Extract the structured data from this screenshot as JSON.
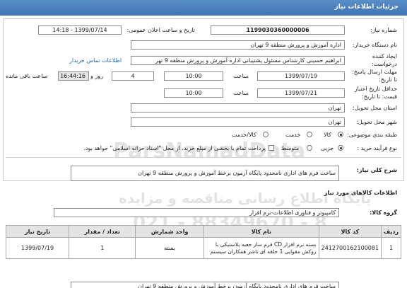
{
  "header": {
    "title": "جزئیات اطلاعات نیاز"
  },
  "form": {
    "need_number_label": "شماره نیاز:",
    "need_number": "1199030360000006",
    "announce_label": "تاریخ و ساعت اعلان عمومی:",
    "announce_value": "1399/07/14 - 14:18",
    "buyer_label": "نام دستگاه خریدار:",
    "buyer_value": "اداره آموزش و پرورش منطقه 9 تهران",
    "creator_label_1": "ایجاد کننده",
    "creator_label_2": "درخواست:",
    "creator_value": "ابراهیم حسینی کارشناس مسئول پشتیبانی اداره آموزش و پرورش منطقه 9 تهر",
    "contact_link": "اطلاعات تماس خریدار",
    "deadline_label_1": "مهلت ارسال پاسخ:",
    "deadline_label_2": "تا تاریخ:",
    "deadline_date": "1399/07/19",
    "time_label": "ساعت",
    "deadline_time": "10:00",
    "days_value": "4",
    "days_label": "روز و",
    "remaining_time": "16:44:16",
    "remaining_label": "ساعت باقی مانده",
    "validity_label_1": "حداقل تاریخ اعتبار",
    "validity_label_2": "قیمت: تا تاریخ:",
    "validity_date": "1399/07/21",
    "validity_time": "10:00",
    "province_label": "استان محل تحویل:",
    "province_value": "تهران",
    "city_label": "شهر محل تحویل:",
    "city_value": "تهران",
    "category_label": "طبقه بندی موضوعی:",
    "category_options": [
      "کالا",
      "خدمت",
      "کالا/خدمت"
    ],
    "process_label": "نوع فرآیند خرید :",
    "process_options": [
      "جزیی",
      "متوسط"
    ],
    "payment_note": "پرداخت تمام یا بخشی از مبلغ خرید، از محل \"اسناد خزانه اسلامی\" خواهد بود."
  },
  "summary": {
    "label": "شرح کلی نیاز:",
    "value": "ساخت فرم های اداری نامحدود پایگاه آزمون برخط آموزش و پرورش منطقه 9 تهران"
  },
  "goods_section": {
    "title": "اطلاعات کالاهای مورد نیاز",
    "group_label": "گروه کالا:",
    "group_value": "کامپیوتر و فناوری اطلاعات-نرم افزار"
  },
  "table": {
    "headers": [
      "ردیف",
      "کد کالا",
      "نام کالا",
      "واحد شمارش",
      "تعداد / مقدار",
      "تاریخ نیاز"
    ],
    "rows": [
      {
        "row": "1",
        "code": "2412700162100081",
        "name": "بسته نرم افزار CD فرم ساز جعبه پلاستیکی با روکش مقوایی 1 حلقه ای ناشر همکاران سیستم",
        "unit": "بسته",
        "qty": "1",
        "date": "1399/07/19"
      }
    ]
  },
  "footer_note": "ساخت فرم های اداری نامحدود پایگاه آزمون برخط آموزش و پرورش منطقه 9 تهران",
  "watermark": {
    "brand": "ParsNamadData",
    "line1": "پایگاه اطلاع رسانی مناقصه و مزایده",
    "phone": "021 - 88349670 - 8"
  }
}
